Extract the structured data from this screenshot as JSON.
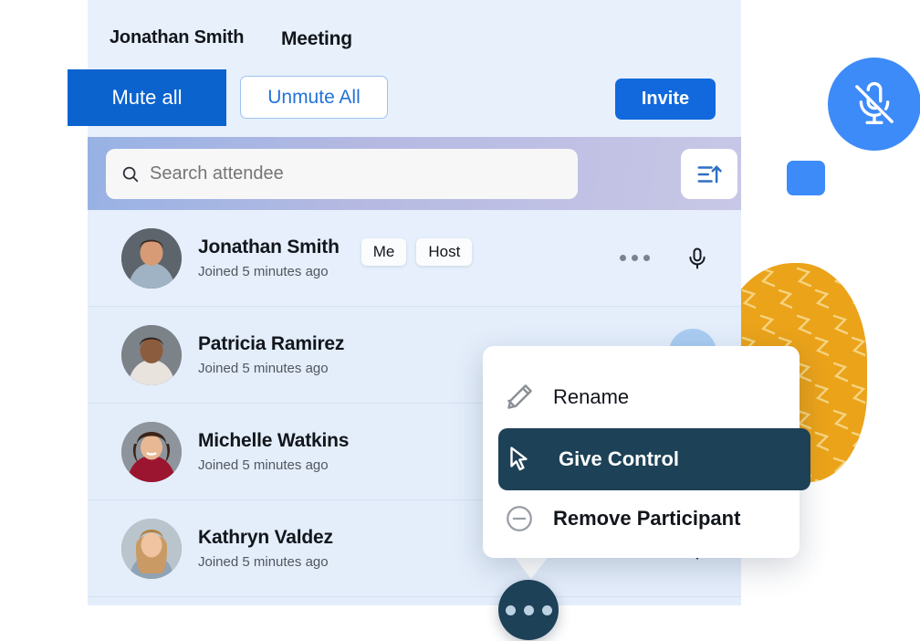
{
  "header": {
    "user_name": "Jonathan Smith",
    "meeting_label": "Meeting"
  },
  "actions": {
    "mute_all": "Mute all",
    "unmute_all": "Unmute All",
    "invite": "Invite"
  },
  "search": {
    "placeholder": "Search attendee",
    "value": "",
    "search_icon": "search-icon",
    "sort_icon": "sort-ascending-icon",
    "filter_icon": "filter-funnel-icon"
  },
  "participants": [
    {
      "name": "Jonathan Smith",
      "joined": "Joined 5 minutes ago",
      "badges": [
        "Me",
        "Host"
      ],
      "mic_icon": "microphone-icon",
      "more_icon": "more-options-icon"
    },
    {
      "name": "Patricia Ramirez",
      "joined": "Joined 5 minutes ago",
      "badges": [],
      "mic_icon": "microphone-icon",
      "more_icon": "more-options-icon"
    },
    {
      "name": "Michelle Watkins",
      "joined": "Joined 5 minutes ago",
      "badges": [],
      "mic_icon": "microphone-icon",
      "more_icon": "more-options-icon"
    },
    {
      "name": "Kathryn Valdez",
      "joined": "Joined 5 minutes ago",
      "badges": [],
      "mic_icon": "microphone-icon",
      "more_icon": "more-options-icon"
    }
  ],
  "context_menu": {
    "items": [
      {
        "label": "Rename",
        "icon": "pencil-icon",
        "selected": false
      },
      {
        "label": "Give Control",
        "icon": "cursor-arrow-icon",
        "selected": true
      },
      {
        "label": "Remove Participant",
        "icon": "minus-circle-icon",
        "selected": false
      }
    ]
  },
  "fab": {
    "name": "more-options-fab",
    "icon": "three-dots-icon"
  },
  "decorations": {
    "mic_muted_icon": "microphone-muted-icon",
    "blob_icon": "zigzag-blob-shape",
    "square_icon": "blue-square-shape"
  },
  "colors": {
    "primary_blue": "#0b63ce",
    "invite_blue": "#1169dd",
    "panel_bg": "#e8f0fb",
    "list_bg": "#e4eefb",
    "menu_selected": "#1d4157",
    "accent_yellow": "#eba31a",
    "accent_light_blue": "#3d8bf8"
  }
}
